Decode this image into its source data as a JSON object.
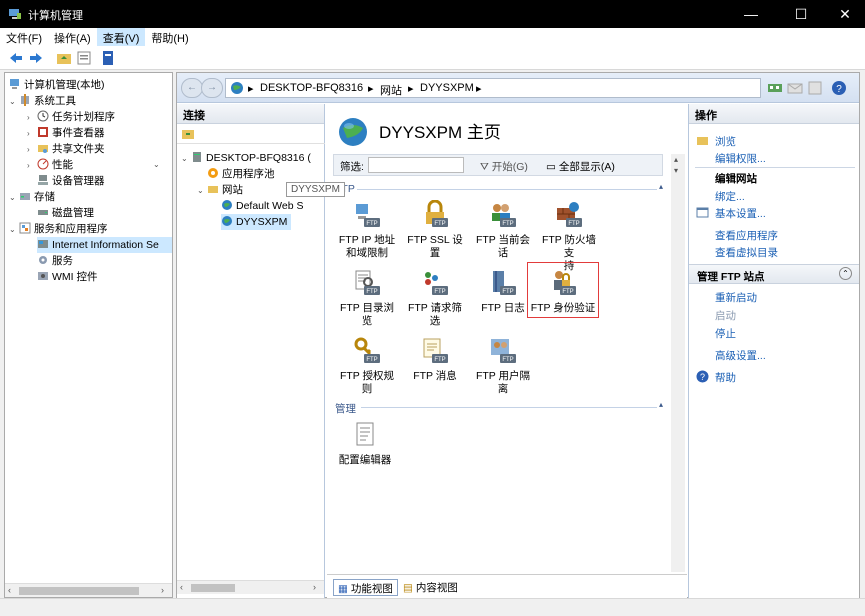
{
  "window": {
    "title": "计算机管理",
    "minimize": "—",
    "maximize": "☐",
    "close": "✕"
  },
  "menu": [
    "文件(F)",
    "操作(A)",
    "查看(V)",
    "帮助(H)"
  ],
  "tree": {
    "root": "计算机管理(本地)",
    "system_tools": "系统工具",
    "task_scheduler": "任务计划程序",
    "event_viewer": "事件查看器",
    "shared_folders": "共享文件夹",
    "performance": "性能",
    "device_manager": "设备管理器",
    "storage": "存储",
    "disk_management": "磁盘管理",
    "services_apps": "服务和应用程序",
    "iis": "Internet Information Se",
    "services": "服务",
    "wmi": "WMI 控件"
  },
  "address": {
    "host": "DESKTOP-BFQ8316",
    "sites": "网站",
    "site": "DYYSXPM"
  },
  "connections": {
    "header": "连接",
    "host": "DESKTOP-BFQ8316 (",
    "app_pools": "应用程序池",
    "sites": "网站",
    "default_site": "Default Web S",
    "site": "DYYSXPM"
  },
  "tooltip": "DYYSXPM",
  "center": {
    "title": "DYYSXPM 主页",
    "filter_label": "筛选:",
    "start": "开始(G)",
    "show_all": "全部显示(A)",
    "group_ftp": "FTP",
    "group_manage": "管理",
    "features": [
      {
        "name": "ftp-ip-restriction",
        "line1": "FTP IP 地址",
        "line2": "和域限制"
      },
      {
        "name": "ftp-ssl",
        "line1": "FTP SSL 设置",
        "line2": ""
      },
      {
        "name": "ftp-sessions",
        "line1": "FTP 当前会话",
        "line2": ""
      },
      {
        "name": "ftp-firewall",
        "line1": "FTP 防火墙支",
        "line2": "持"
      },
      {
        "name": "ftp-dir-browse",
        "line1": "FTP 目录浏览",
        "line2": ""
      },
      {
        "name": "ftp-request-filter",
        "line1": "FTP 请求筛选",
        "line2": ""
      },
      {
        "name": "ftp-log",
        "line1": "FTP 日志",
        "line2": ""
      },
      {
        "name": "ftp-auth",
        "line1": "FTP 身份验证",
        "line2": ""
      },
      {
        "name": "ftp-authz-rules",
        "line1": "FTP 授权规则",
        "line2": ""
      },
      {
        "name": "ftp-messages",
        "line1": "FTP 消息",
        "line2": ""
      },
      {
        "name": "ftp-user-isolation",
        "line1": "FTP 用户隔离",
        "line2": ""
      }
    ],
    "config_editor": "配置编辑器",
    "tab_features": "功能视图",
    "tab_content": "内容视图"
  },
  "actions": {
    "header": "操作",
    "browse": "浏览",
    "edit_perms": "编辑权限...",
    "edit_site": "编辑网站",
    "bindings": "绑定...",
    "basic_settings": "基本设置...",
    "view_apps": "查看应用程序",
    "view_vdirs": "查看虚拟目录",
    "manage_ftp": "管理 FTP 站点",
    "restart": "重新启动",
    "start": "启动",
    "stop": "停止",
    "advanced": "高级设置...",
    "help": "帮助"
  }
}
